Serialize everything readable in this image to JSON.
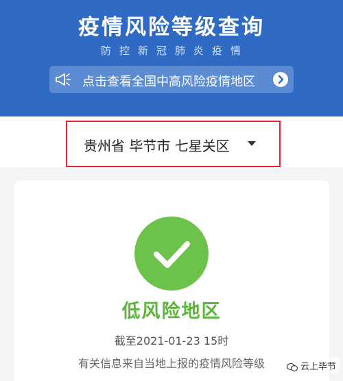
{
  "header": {
    "title": "疫情风险等级查询",
    "subtitle": "防控新冠肺炎疫情",
    "notice": {
      "icon": "megaphone-icon",
      "label": "点击查看全国中高风险疫情地区",
      "arrow_icon": "chevron-right-icon"
    }
  },
  "region": {
    "label": "贵州省 毕节市 七星关区",
    "caret_icon": "caret-down-icon"
  },
  "result": {
    "icon": "check-icon",
    "level": "低风险地区",
    "as_of": "截至2021-01-23 15时",
    "note": "有关信息来自当地上报的疫情风险等级"
  },
  "watermark": {
    "label": "云上毕节",
    "icon": "wechat-icon"
  },
  "colors": {
    "header_blue": "#2f6bc4",
    "notice_bg": "#5b8bd3",
    "highlight_red": "#e0262c",
    "low_risk_green": "#6cc24a"
  }
}
